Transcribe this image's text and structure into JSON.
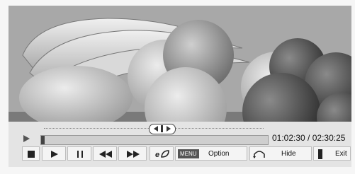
{
  "player": {
    "progress": 0.0167,
    "elapsed": "01:02:30",
    "separator": " / ",
    "total": "02:30:25"
  },
  "buttons": {
    "stop": {
      "icon": "stop-icon"
    },
    "play": {
      "icon": "play-icon"
    },
    "pause": {
      "icon": "pause-icon"
    },
    "rewind": {
      "icon": "rewind-icon"
    },
    "fast_forward": {
      "icon": "fast-forward-icon"
    },
    "energy": {
      "icon": "energy-saving-icon"
    },
    "option": {
      "badge": "MENU",
      "label": "Option"
    },
    "hide": {
      "icon": "return-icon",
      "label": "Hide"
    },
    "exit": {
      "icon": "exit-icon",
      "label": "Exit"
    }
  }
}
